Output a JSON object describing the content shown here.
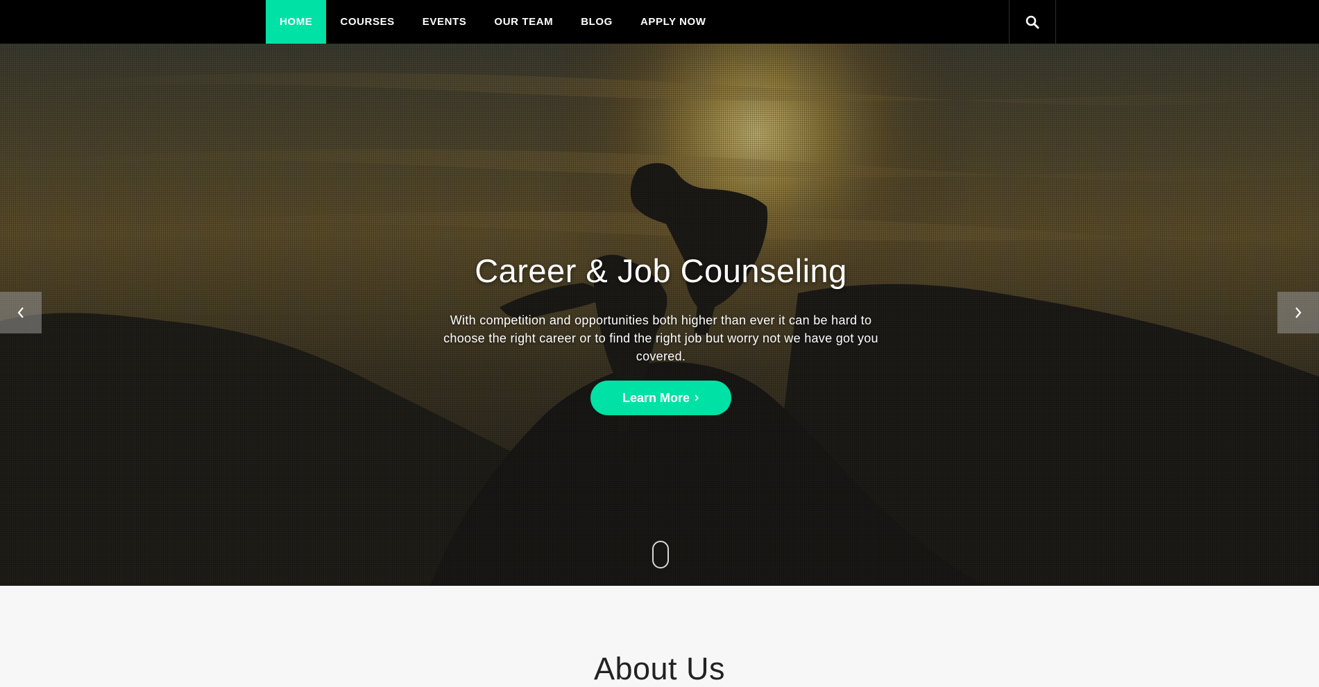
{
  "nav": {
    "items": [
      {
        "label": "HOME",
        "active": true
      },
      {
        "label": "COURSES",
        "active": false
      },
      {
        "label": "EVENTS",
        "active": false
      },
      {
        "label": "OUR TEAM",
        "active": false
      },
      {
        "label": "BLOG",
        "active": false
      },
      {
        "label": "APPLY NOW",
        "active": false
      }
    ],
    "search_icon": "search-icon"
  },
  "hero": {
    "title": "Career & Job Counseling",
    "description": "With competition and opportunities both higher than ever it can be hard to choose the right career or to find the right job but worry not we have got you covered.",
    "button_label": "Learn More",
    "button_icon": "chevron-right-icon",
    "prev_icon": "chevron-left-icon",
    "next_icon": "chevron-right-icon",
    "scroll_icon": "mouse-scroll-icon"
  },
  "about": {
    "title": "About Us"
  },
  "colors": {
    "accent": "#00e1a5",
    "navbar": "#000000",
    "page_bg": "#f7f7f7"
  }
}
